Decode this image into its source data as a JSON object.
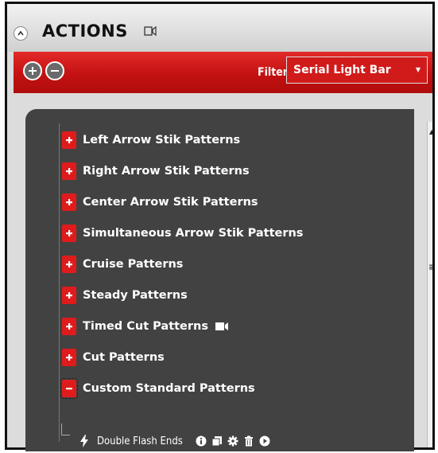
{
  "header": {
    "title": "ACTIONS"
  },
  "toolbar": {
    "filter_label": "Filter:",
    "filter_value": "Serial Light Bar"
  },
  "tree": {
    "items": [
      {
        "label": "Left Arrow Stik Patterns",
        "state": "collapsed"
      },
      {
        "label": "Right Arrow Stik Patterns",
        "state": "collapsed"
      },
      {
        "label": "Center Arrow Stik Patterns",
        "state": "collapsed"
      },
      {
        "label": "Simultaneous Arrow Stik Patterns",
        "state": "collapsed"
      },
      {
        "label": "Cruise Patterns",
        "state": "collapsed"
      },
      {
        "label": "Steady Patterns",
        "state": "collapsed"
      },
      {
        "label": "Timed Cut Patterns",
        "state": "collapsed",
        "icon": "video-icon"
      },
      {
        "label": "Cut Patterns",
        "state": "collapsed"
      },
      {
        "label": "Custom Standard Patterns",
        "state": "expanded"
      }
    ],
    "child": {
      "label": "Double Flash Ends",
      "icons": [
        "info-icon",
        "copy-icon",
        "gear-icon",
        "trash-icon",
        "play-icon"
      ]
    }
  },
  "colors": {
    "accent": "#d11a1a",
    "tree_bg": "#424242",
    "plus_red": "#e01b1b"
  }
}
